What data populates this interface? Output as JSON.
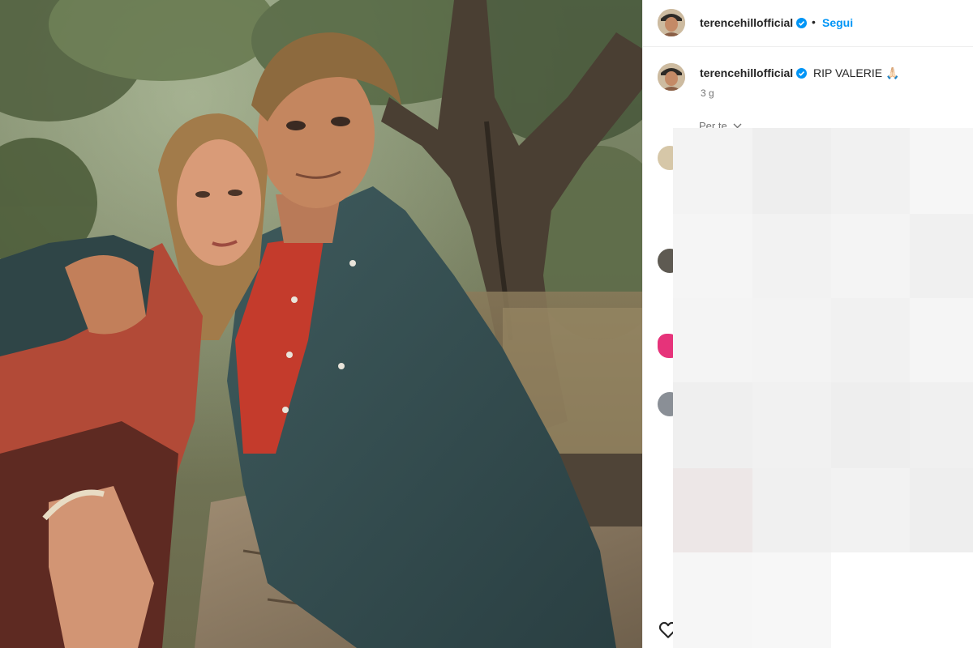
{
  "post": {
    "account": {
      "username": "terencehillofficial",
      "verified": true,
      "verified_icon": "verified-badge-icon"
    },
    "header": {
      "separator": "•",
      "follow_label": "Segui"
    },
    "caption": {
      "text": "RIP VALERIE",
      "emoji": "🙏🏻",
      "time_ago": "3 g"
    },
    "comments_filter": {
      "label": "Per te",
      "icon": "chevron-down-icon"
    },
    "actions": {
      "like_icon": "heart-icon"
    }
  },
  "colors": {
    "accent": "#0095f6",
    "text_primary": "#262626",
    "text_secondary": "#737373",
    "divider": "#efefef"
  }
}
